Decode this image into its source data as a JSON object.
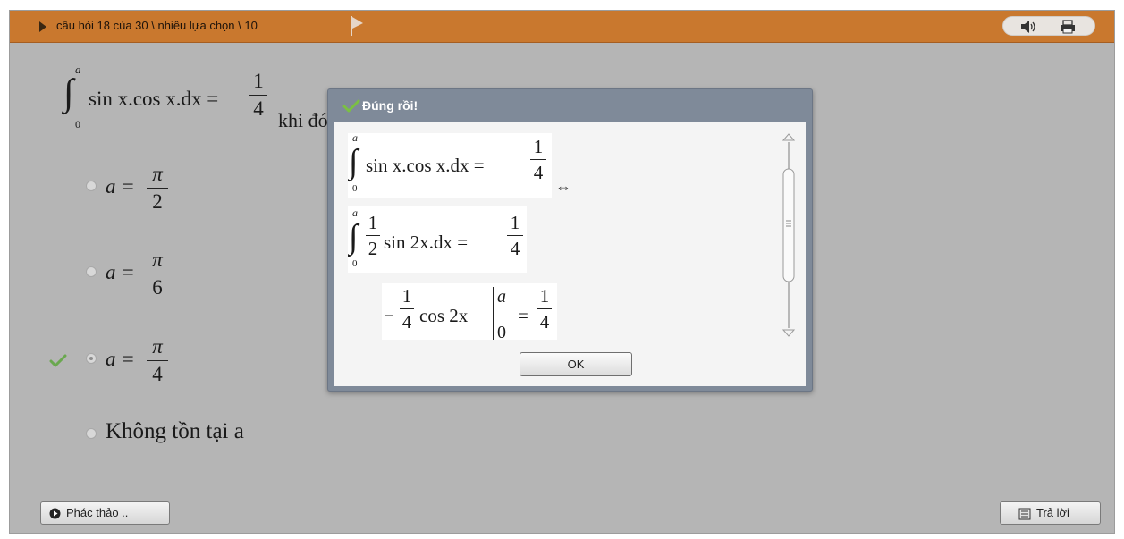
{
  "topbar": {
    "breadcrumb": "câu hỏi 18 của 30 \\ nhiều lựa chọn \\ 10",
    "icons": {
      "nav": "triangle-right-icon",
      "flag": "flag-icon",
      "audio": "speaker-icon",
      "print": "printer-icon"
    }
  },
  "question": {
    "integral_upper": "a",
    "integral_lower": "0",
    "integrand": "sin x.cos x.dx =",
    "rhs_num": "1",
    "rhs_den": "4",
    "text": "khi đó giá trị của a = ?"
  },
  "options": [
    {
      "lhs": "a =",
      "num": "π",
      "den": "2",
      "selected": false
    },
    {
      "lhs": "a =",
      "num": "π",
      "den": "6",
      "selected": false
    },
    {
      "lhs": "a =",
      "num": "π",
      "den": "4",
      "selected": true
    },
    {
      "text": "Không tồn tại a",
      "selected": false
    }
  ],
  "dialog": {
    "title": "Đúng rồi!",
    "line1": {
      "upper": "a",
      "lower": "0",
      "expr": "sin x.cos x.dx =",
      "num": "1",
      "den": "4",
      "suffix": "⇔"
    },
    "line2": {
      "upper": "a",
      "lower": "0",
      "frac_num": "1",
      "frac_den": "2",
      "expr": "sin 2x.dx =",
      "num": "1",
      "den": "4"
    },
    "line3": {
      "minus": "−",
      "frac_num": "1",
      "frac_den": "4",
      "expr": "cos 2x",
      "bar_upper": "a",
      "bar_lower": "0",
      "eq": "=",
      "num": "1",
      "den": "4"
    },
    "ok_label": "OK"
  },
  "buttons": {
    "draft_label": "Phác thảo ..",
    "answer_label": "Trả lời"
  },
  "colors": {
    "topbar": "#c9782e",
    "background": "#b5b5b5",
    "dialog_frame": "#7f8a99",
    "check_green": "#6aa84f"
  }
}
